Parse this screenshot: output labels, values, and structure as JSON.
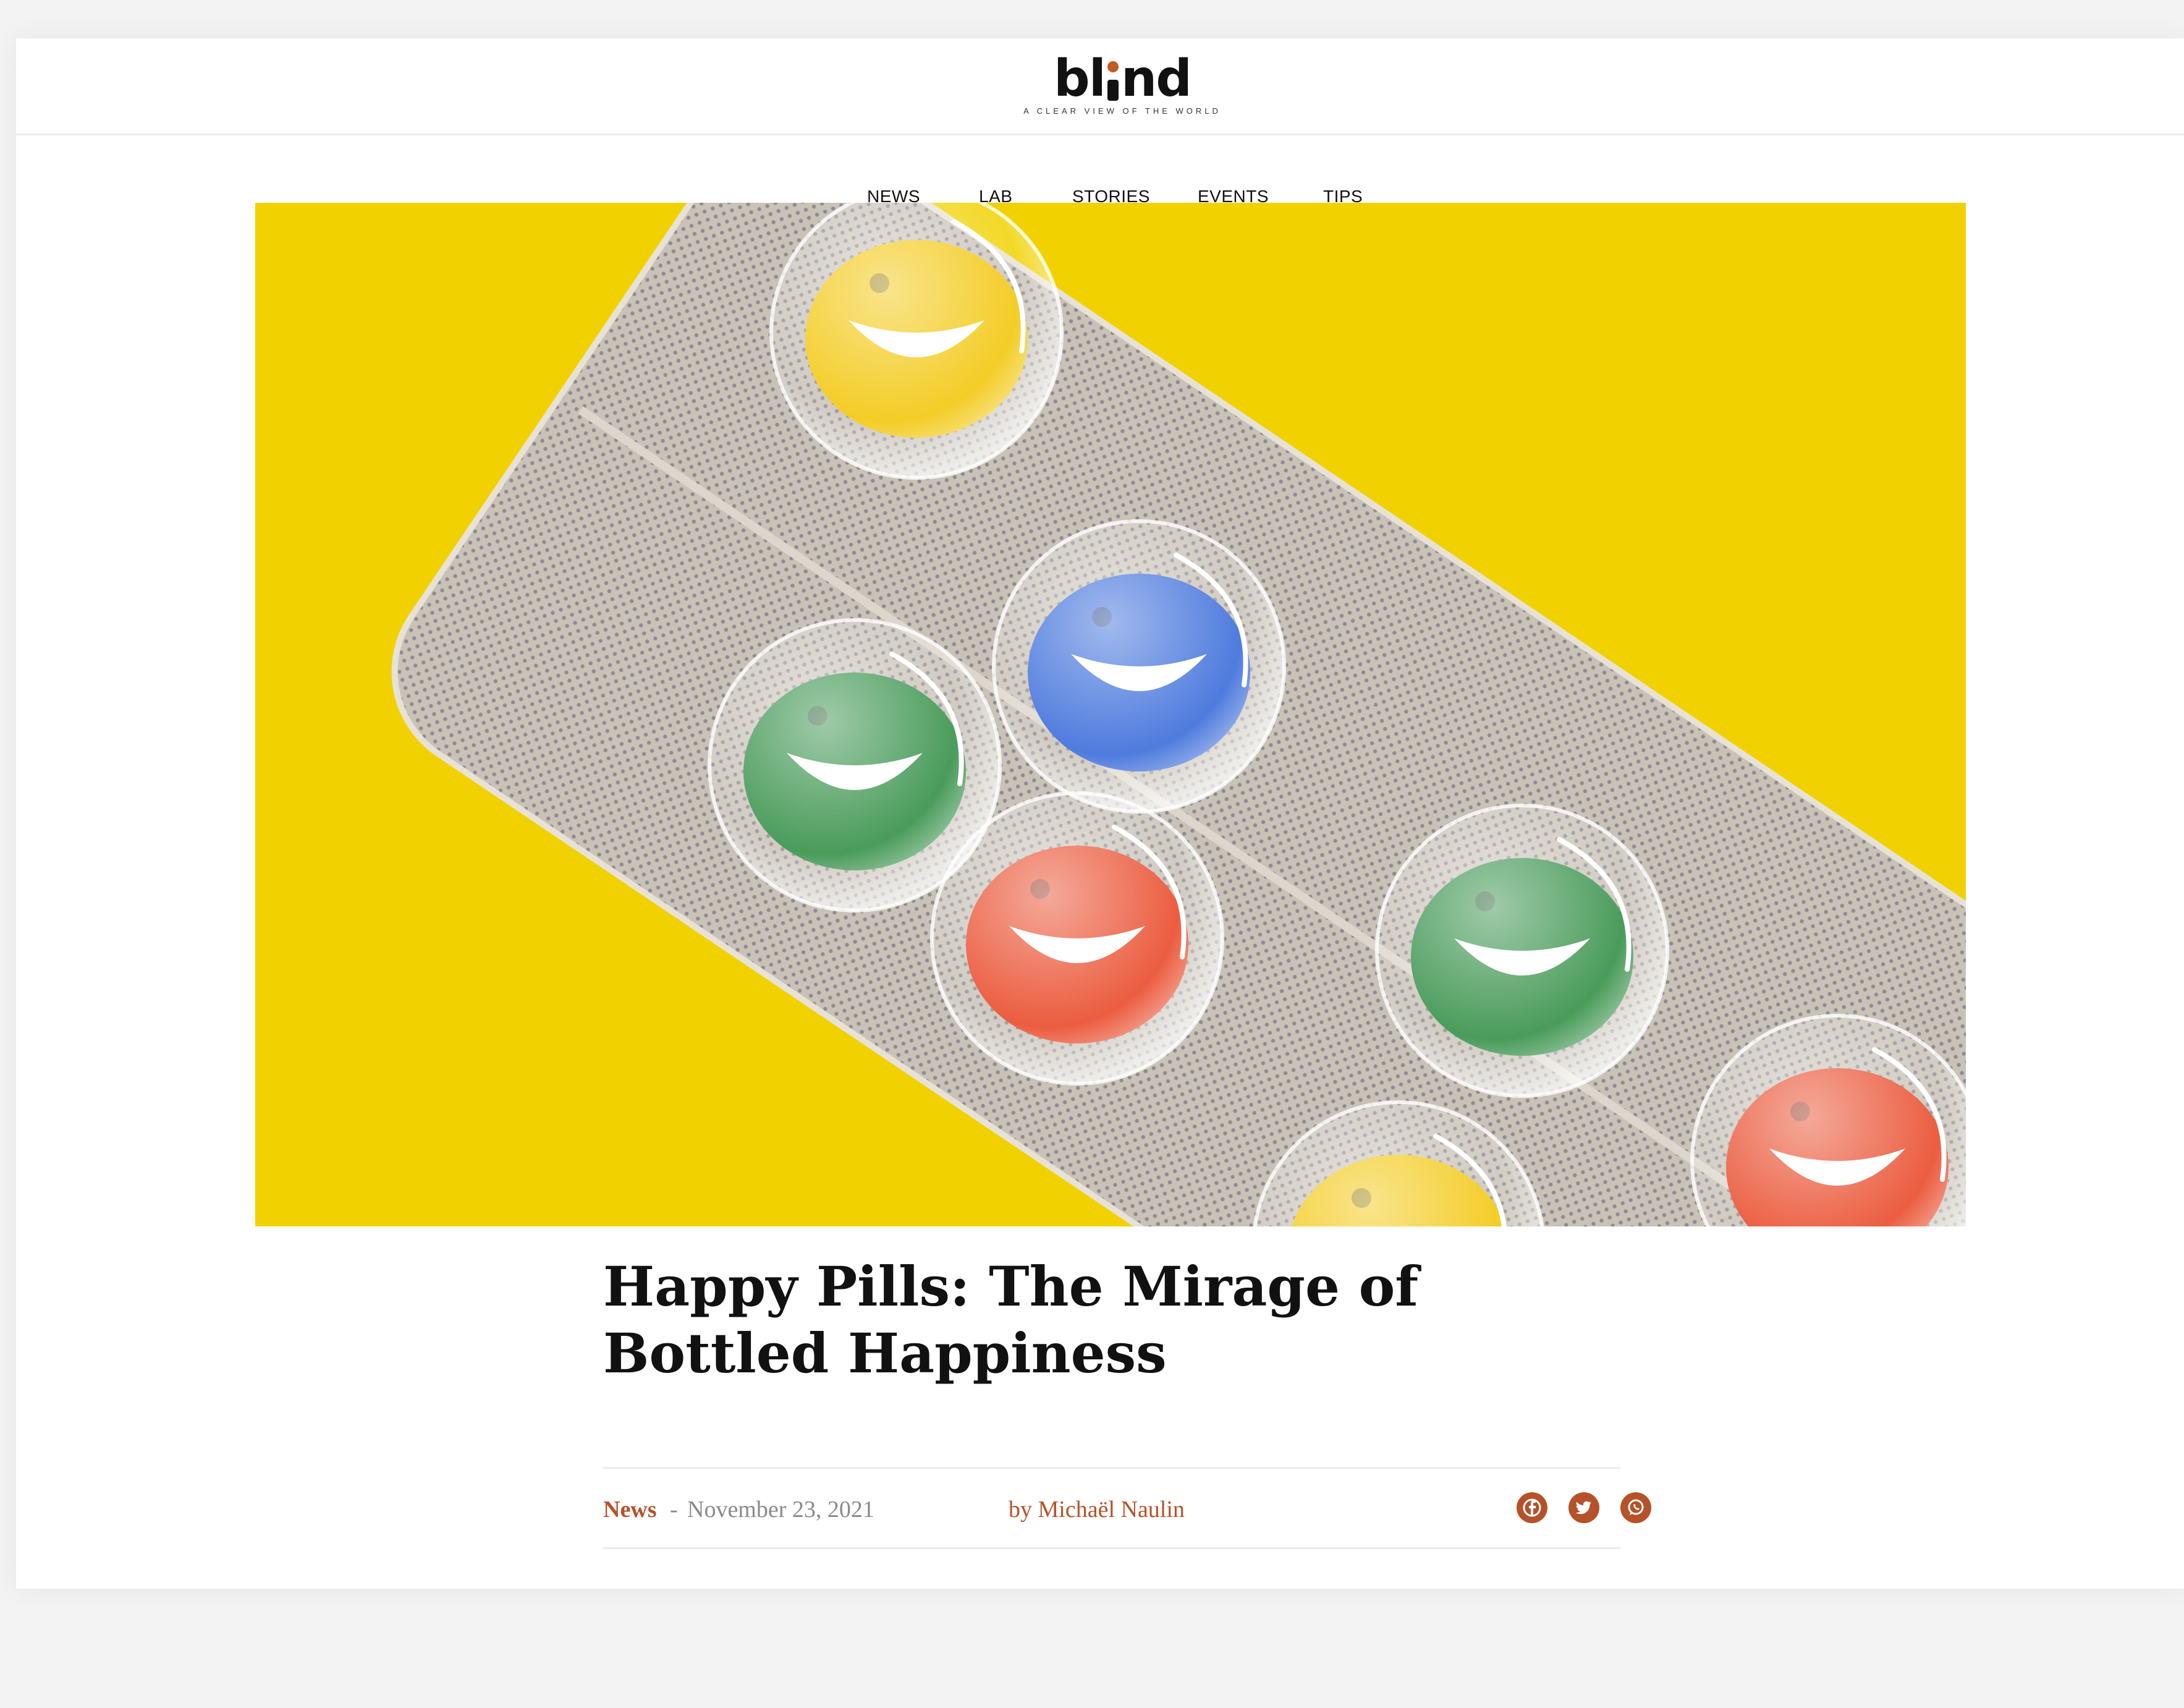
{
  "site": {
    "logo_text": "blind",
    "tagline": "A CLEAR VIEW OF THE WORLD",
    "accent_color": "#b5522a"
  },
  "nav": {
    "items": [
      {
        "label": "NEWS"
      },
      {
        "label": "LAB"
      },
      {
        "label": "STORIES"
      },
      {
        "label": "EVENTS"
      },
      {
        "label": "TIPS"
      }
    ]
  },
  "hero": {
    "background_color": "#f1d200",
    "pill_colors": [
      "#f2c400",
      "#2a8a3e",
      "#2f64d8",
      "#e8401e"
    ]
  },
  "article": {
    "title": "Happy Pills: The Mirage of Bottled Happiness",
    "category": "News",
    "separator": "-",
    "date": "November 23, 2021",
    "author": "by Michaël Naulin"
  },
  "share": {
    "icons": [
      "facebook-icon",
      "twitter-icon",
      "whatsapp-icon"
    ]
  }
}
